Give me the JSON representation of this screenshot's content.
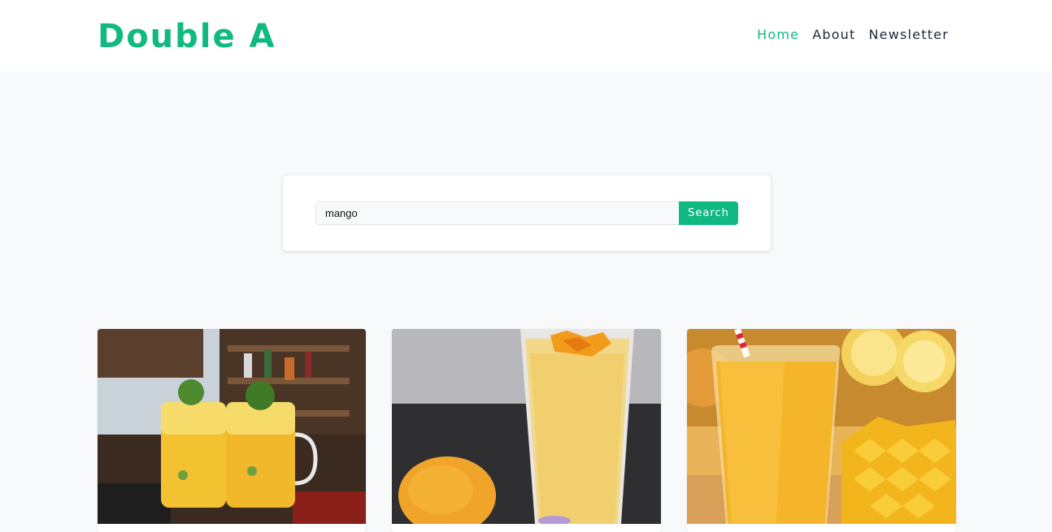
{
  "header": {
    "brand": "Double A",
    "nav": [
      {
        "label": "Home",
        "active": true
      },
      {
        "label": "About",
        "active": false
      },
      {
        "label": "Newsletter",
        "active": false
      }
    ]
  },
  "search": {
    "value": "mango",
    "button_label": "Search"
  },
  "colors": {
    "accent": "#10b981",
    "background": "#f8f9fb",
    "text": "#1f2937"
  },
  "cards": [
    {
      "image": "mango-mojito-mason-jars-photo"
    },
    {
      "image": "mango-smoothie-tall-glass-photo"
    },
    {
      "image": "mango-juice-glass-with-straw-photo"
    }
  ]
}
